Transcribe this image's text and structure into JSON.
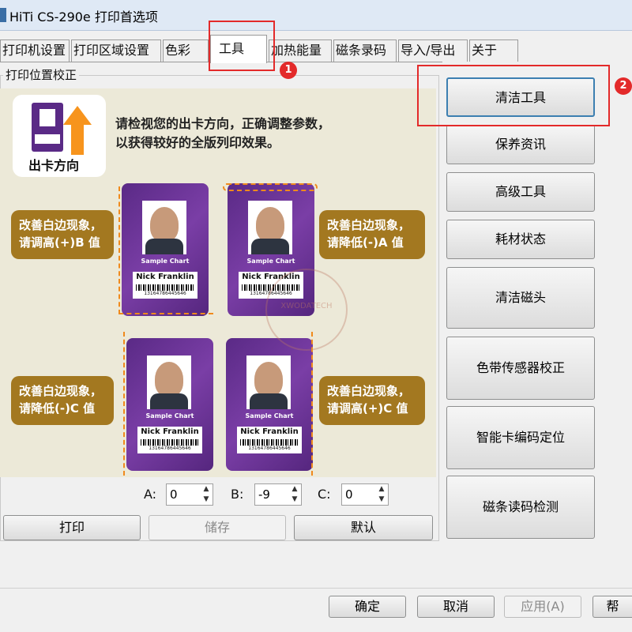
{
  "window": {
    "title": "HiTi CS-290e 打印首选项"
  },
  "tabs": [
    {
      "label": "打印机设置"
    },
    {
      "label": "打印区域设置"
    },
    {
      "label": "色彩"
    },
    {
      "label": "工具"
    },
    {
      "label": "加热能量"
    },
    {
      "label": "磁条录码"
    },
    {
      "label": "导入/导出"
    },
    {
      "label": "关于"
    }
  ],
  "group": {
    "label": "打印位置校正"
  },
  "illustration": {
    "out_direction_label": "出卡方向",
    "instruction_line1": "请检视您的出卡方向，正确调整参数，",
    "instruction_line2": "以获得较好的全版列印效果。",
    "card": {
      "sample_text": "Sample Chart",
      "name": "Nick Franklin",
      "number": "13164786445646"
    },
    "callouts": {
      "top_left_line1": "改善白边现象，",
      "top_left_line2": "请调高(+)B 值",
      "top_right_line1": "改善白边现象，",
      "top_right_line2": "请降低(-)A 值",
      "bottom_left_line1": "改善白边现象，",
      "bottom_left_line2": "请降低(-)C 值",
      "bottom_right_line1": "改善白边现象，",
      "bottom_right_line2": "请调高(+)C 值"
    },
    "watermark": "XWODATECH"
  },
  "spinners": {
    "a": {
      "label": "A:",
      "value": "0"
    },
    "b": {
      "label": "B:",
      "value": "-9"
    },
    "c": {
      "label": "C:",
      "value": "0"
    }
  },
  "actions": {
    "print": "打印",
    "save": "储存",
    "default": "默认"
  },
  "side_buttons": [
    {
      "label": "清洁工具"
    },
    {
      "label": "保养资讯"
    },
    {
      "label": "高级工具"
    },
    {
      "label": "耗材状态"
    },
    {
      "label": "清洁磁头"
    },
    {
      "label": "色带传感器校正"
    },
    {
      "label": "智能卡编码定位"
    },
    {
      "label": "磁条读码检测"
    }
  ],
  "annotations": {
    "marker1": "1",
    "marker2": "2",
    "color": "#e32a2a"
  },
  "footer": {
    "ok": "确定",
    "cancel": "取消",
    "apply": "应用(A)",
    "help": "帮"
  },
  "colors": {
    "card_purple": "#5a2a86",
    "callout_brown": "#a37820",
    "dash_orange": "#f08a1c",
    "arrow_orange": "#f7941d"
  }
}
